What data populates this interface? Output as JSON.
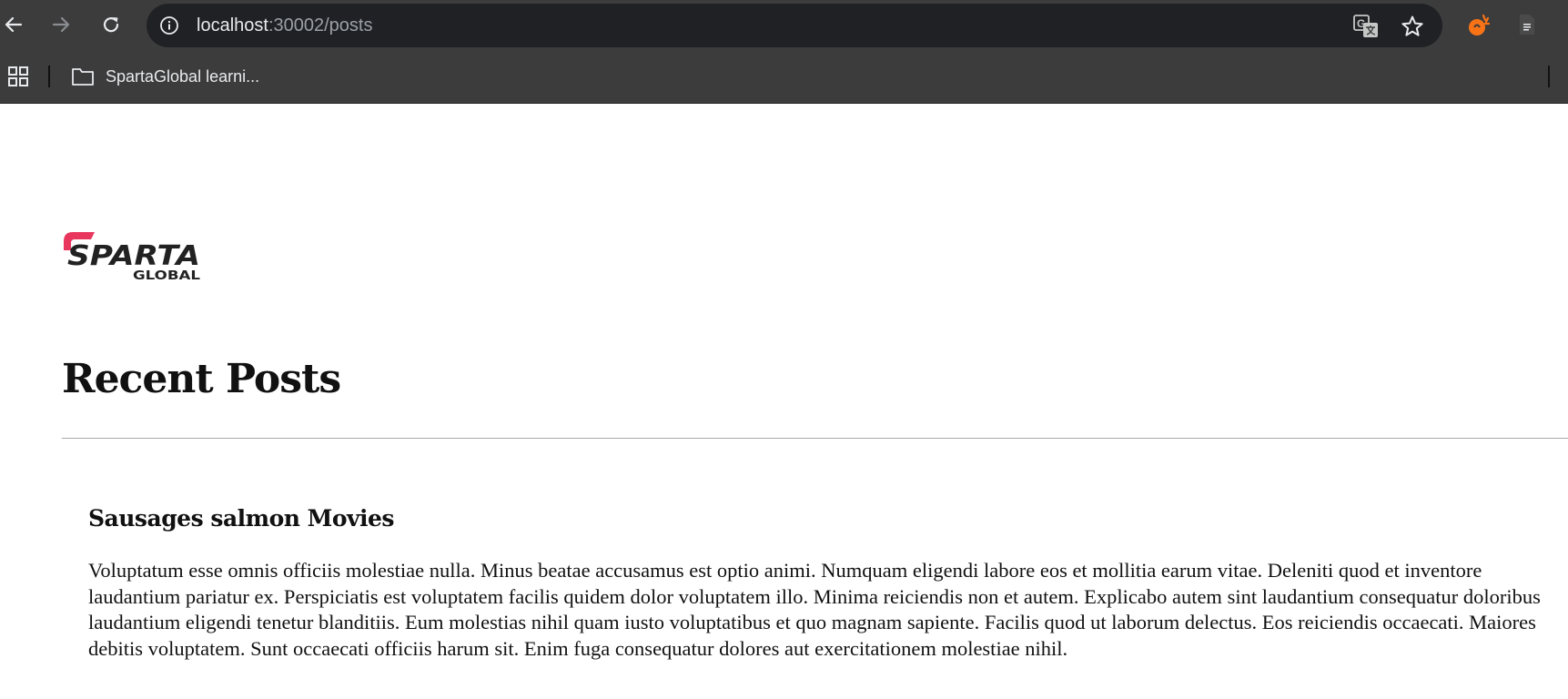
{
  "browser": {
    "url_host": "localhost",
    "url_path": ":30002/posts",
    "bookmarks": [
      {
        "label": "SpartaGlobal learni..."
      }
    ]
  },
  "colors": {
    "chrome_bg": "#3c3c3c",
    "omnibox_bg": "#202124",
    "brand_pink": "#e8365d",
    "ext_orange": "#f97316"
  },
  "page": {
    "logo": {
      "word": "SPARTA",
      "sub": "GLOBAL"
    },
    "title": "Recent Posts",
    "posts": [
      {
        "title": "Sausages salmon Movies",
        "body": "Voluptatum esse omnis officiis molestiae nulla. Minus beatae accusamus est optio animi. Numquam eligendi labore eos et mollitia earum vitae. Deleniti quod et inventore laudantium pariatur ex. Perspiciatis est voluptatem facilis quidem dolor voluptatem illo. Minima reiciendis non et autem. Explicabo autem sint laudantium consequatur doloribus laudantium eligendi tenetur blanditiis. Eum molestias nihil quam iusto voluptatibus et quo magnam sapiente. Facilis quod ut laborum delectus. Eos reiciendis occaecati. Maiores debitis voluptatem. Sunt occaecati officiis harum sit. Enim fuga consequatur dolores aut exercitationem molestiae nihil."
      }
    ]
  }
}
